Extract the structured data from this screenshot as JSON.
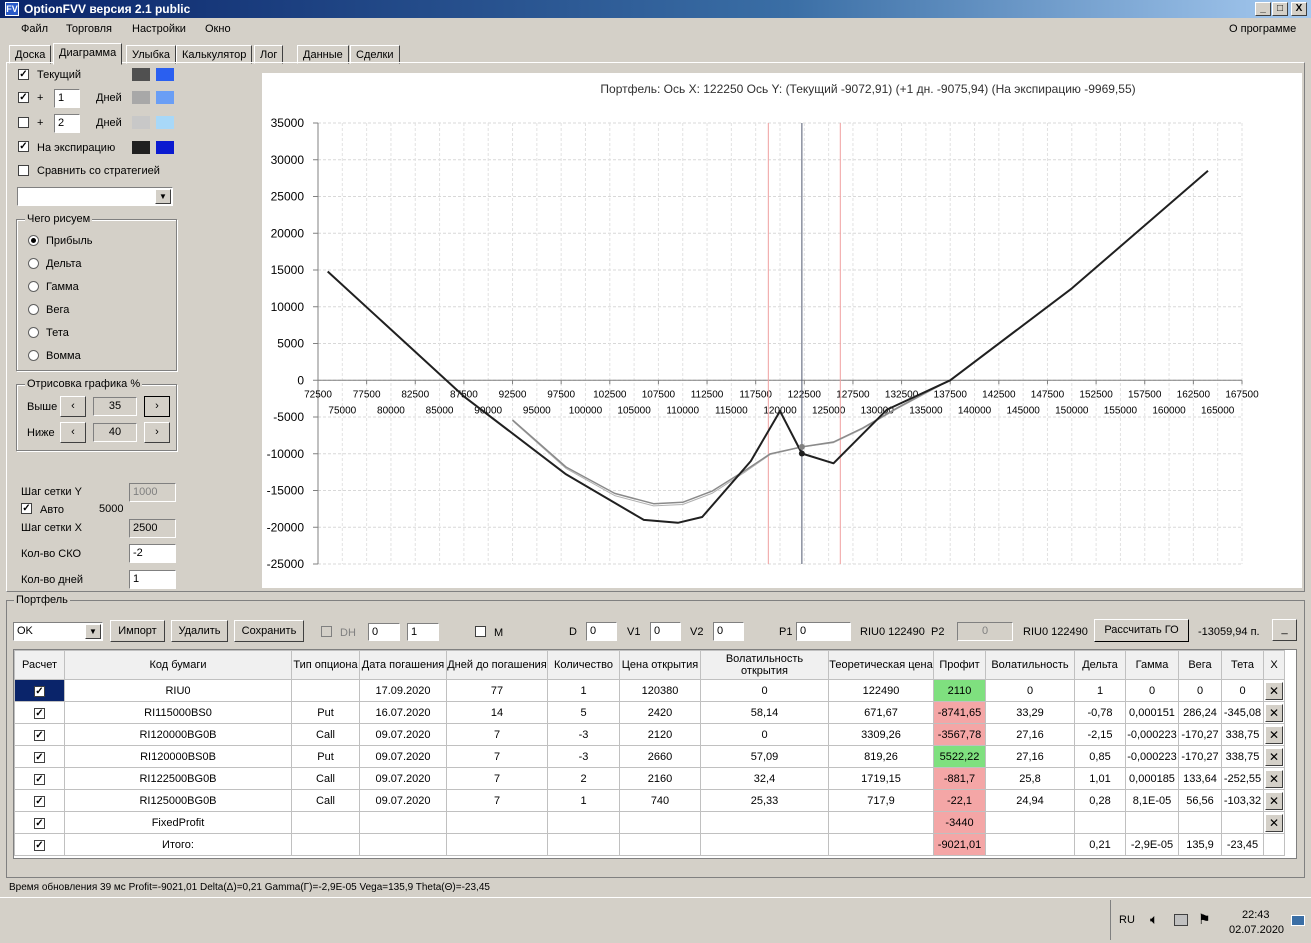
{
  "window": {
    "title": "OptionFVV версия 2.1 public",
    "icon_letter": "FV",
    "min": "_",
    "max": "□",
    "close": "X"
  },
  "menu": {
    "items": [
      "Файл",
      "Торговля",
      "Настройки",
      "Окно"
    ],
    "about": "О программе"
  },
  "tabs": [
    "Доска",
    "Диаграмма",
    "Улыбка",
    "Калькулятор",
    "Лог",
    "Данные",
    "Сделки"
  ],
  "active_tab": 1,
  "left": {
    "current_label": "Текущий",
    "plus_label": "+",
    "plus1_value": "1",
    "plus2_value": "2",
    "days_label": "Дней",
    "expiry_label": "На экспирацию",
    "compare_label": "Сравнить со стратегией",
    "compare_value": "",
    "what_title": "Чего рисуем",
    "radios": [
      "Прибыль",
      "Дельта",
      "Гамма",
      "Вега",
      "Тета",
      "Вомма"
    ],
    "selected_radio": 0,
    "render_title": "Отрисовка графика %",
    "above_label": "Выше",
    "above_value": "35",
    "below_label": "Ниже",
    "below_value": "40",
    "gridY_label": "Шаг сетки Y",
    "gridY_value": "1000",
    "auto_label": "Авто",
    "auto_value": "5000",
    "gridX_label": "Шаг сетки X",
    "gridX_value": "2500",
    "sko_label": "Кол-во СКО",
    "sko_value": "-2",
    "days_count_label": "Кол-во дней",
    "days_count_value": "1",
    "swatch_colors": [
      [
        "#505050",
        "#2a5ff0"
      ],
      [
        "#a8a8a8",
        "#6a9ef5"
      ],
      [
        "#c8c8c8",
        "#a8d8f8"
      ],
      [
        "#202020",
        "#0a1ad0"
      ]
    ],
    "checks": [
      true,
      true,
      false,
      true,
      false
    ]
  },
  "chart_data": {
    "type": "line",
    "title": "Портфель:  Ось X:  122250  Ось Y:   (Текущий -9072,91)   (+1 дн. -9075,94)   (На экспирацию -9969,55)",
    "xlim": [
      72500,
      167500
    ],
    "ylim": [
      -25000,
      35000
    ],
    "yticks": [
      35000,
      30000,
      25000,
      20000,
      15000,
      10000,
      5000,
      0,
      -5000,
      -10000,
      -15000,
      -20000,
      -25000
    ],
    "xticks_top": [
      72500,
      77500,
      82500,
      87500,
      92500,
      97500,
      102500,
      107500,
      112500,
      117500,
      122500,
      127500,
      132500,
      137500,
      142500,
      147500,
      152500,
      157500,
      162500,
      167500
    ],
    "xticks_bottom": [
      75000,
      80000,
      85000,
      90000,
      95000,
      100000,
      105000,
      110000,
      115000,
      120000,
      125000,
      130000,
      135000,
      140000,
      145000,
      150000,
      155000,
      160000,
      165000
    ],
    "grid": true,
    "vlines": [
      {
        "x": 118800,
        "color": "#f0a0a0"
      },
      {
        "x": 122250,
        "color": "#505870"
      },
      {
        "x": 126200,
        "color": "#f0a0a0"
      }
    ],
    "series": [
      {
        "color": "#202020",
        "width": 2,
        "points": [
          [
            73500,
            14800
          ],
          [
            87500,
            -2200
          ],
          [
            98000,
            -12800
          ],
          [
            106000,
            -19000
          ],
          [
            109500,
            -19400
          ],
          [
            112000,
            -18600
          ],
          [
            117000,
            -11000
          ],
          [
            120000,
            -4200
          ],
          [
            122250,
            -9969
          ],
          [
            125500,
            -11300
          ],
          [
            131000,
            -4000
          ],
          [
            137500,
            0
          ],
          [
            150000,
            12500
          ],
          [
            164000,
            28500
          ]
        ]
      },
      {
        "color": "#8a8a8a",
        "width": 1.5,
        "points": [
          [
            92500,
            -5400
          ],
          [
            98000,
            -11800
          ],
          [
            103000,
            -15400
          ],
          [
            107000,
            -16800
          ],
          [
            110000,
            -16600
          ],
          [
            113000,
            -15100
          ],
          [
            116500,
            -12200
          ],
          [
            119000,
            -10000
          ],
          [
            122250,
            -9072
          ],
          [
            125500,
            -8400
          ],
          [
            128500,
            -6500
          ],
          [
            132000,
            -3800
          ],
          [
            136500,
            -600
          ]
        ]
      },
      {
        "color": "#b0b0b0",
        "width": 1,
        "points": [
          [
            92500,
            -5500
          ],
          [
            98000,
            -12000
          ],
          [
            103000,
            -15700
          ],
          [
            107000,
            -17100
          ],
          [
            110000,
            -16900
          ],
          [
            113000,
            -15400
          ],
          [
            116500,
            -12400
          ],
          [
            119000,
            -10100
          ],
          [
            122250,
            -9075
          ],
          [
            125500,
            -8500
          ],
          [
            128500,
            -6600
          ],
          [
            132000,
            -3900
          ],
          [
            136500,
            -700
          ]
        ]
      }
    ],
    "markers": [
      {
        "x": 122250,
        "y": -9072,
        "color": "#808080"
      },
      {
        "x": 122250,
        "y": -9969,
        "color": "#202020"
      }
    ]
  },
  "portfolio": {
    "title": "Портфель",
    "select_value": "OK",
    "import": "Импорт",
    "delete": "Удалить",
    "save": "Сохранить",
    "dh": "DH",
    "dh1": "0",
    "dh2": "1",
    "m": "M",
    "d_label": "D",
    "d_value": "0",
    "v1_label": "V1",
    "v1_value": "0",
    "v2_label": "V2",
    "v2_value": "0",
    "p1_label": "P1",
    "p1_value": "0",
    "riu1": "RIU0 122490",
    "p2_label": "P2",
    "p2_value": "0",
    "riu2": "RIU0 122490",
    "calc_go": "Рассчитать ГО",
    "go_value": "-13059,94 п.",
    "minimize": "_"
  },
  "table": {
    "headers": [
      "Расчет",
      "Код бумаги",
      "Тип опциона",
      "Дата погашения",
      "Дней до погашения",
      "Количество",
      "Цена открытия",
      "Волатильность открытия",
      "Теоретическая цена",
      "Профит",
      "Волатильность",
      "Дельта",
      "Гамма",
      "Вега",
      "Тета",
      "X"
    ],
    "rows": [
      [
        "RIU0",
        "",
        "17.09.2020",
        "77",
        "1",
        "120380",
        "0",
        "122490",
        "2110",
        "0",
        "1",
        "0",
        "0",
        "0"
      ],
      [
        "RI115000BS0",
        "Put",
        "16.07.2020",
        "14",
        "5",
        "2420",
        "58,14",
        "671,67",
        "-8741,65",
        "33,29",
        "-0,78",
        "0,000151",
        "286,24",
        "-345,08"
      ],
      [
        "RI120000BG0B",
        "Call",
        "09.07.2020",
        "7",
        "-3",
        "2120",
        "0",
        "3309,26",
        "-3567,78",
        "27,16",
        "-2,15",
        "-0,000223",
        "-170,27",
        "338,75"
      ],
      [
        "RI120000BS0B",
        "Put",
        "09.07.2020",
        "7",
        "-3",
        "2660",
        "57,09",
        "819,26",
        "5522,22",
        "27,16",
        "0,85",
        "-0,000223",
        "-170,27",
        "338,75"
      ],
      [
        "RI122500BG0B",
        "Call",
        "09.07.2020",
        "7",
        "2",
        "2160",
        "32,4",
        "1719,15",
        "-881,7",
        "25,8",
        "1,01",
        "0,000185",
        "133,64",
        "-252,55"
      ],
      [
        "RI125000BG0B",
        "Call",
        "09.07.2020",
        "7",
        "1",
        "740",
        "25,33",
        "717,9",
        "-22,1",
        "24,94",
        "0,28",
        "8,1E-05",
        "56,56",
        "-103,32"
      ],
      [
        "FixedProfit",
        "",
        "",
        "",
        "",
        "",
        "",
        "",
        "-3440",
        "",
        "",
        "",
        "",
        ""
      ],
      [
        "Итого:",
        "",
        "",
        "",
        "",
        "",
        "",
        "",
        "-9021,01",
        "",
        "0,21",
        "-2,9E-05",
        "135,9",
        "-23,45"
      ]
    ],
    "profit_colors": [
      "green",
      "red",
      "red",
      "green",
      "red",
      "red",
      "red",
      "red"
    ],
    "row_has_x": [
      true,
      true,
      true,
      true,
      true,
      true,
      true,
      false
    ]
  },
  "status": "Время обновления 39 мс  Profit=-9021,01 Delta(Δ)=0,21 Gamma(Γ)=-2,9E-05 Vega=135,9 Theta(Θ)=-23,45",
  "taskbar": {
    "lang": "RU",
    "time": "22:43",
    "date": "02.07.2020"
  }
}
